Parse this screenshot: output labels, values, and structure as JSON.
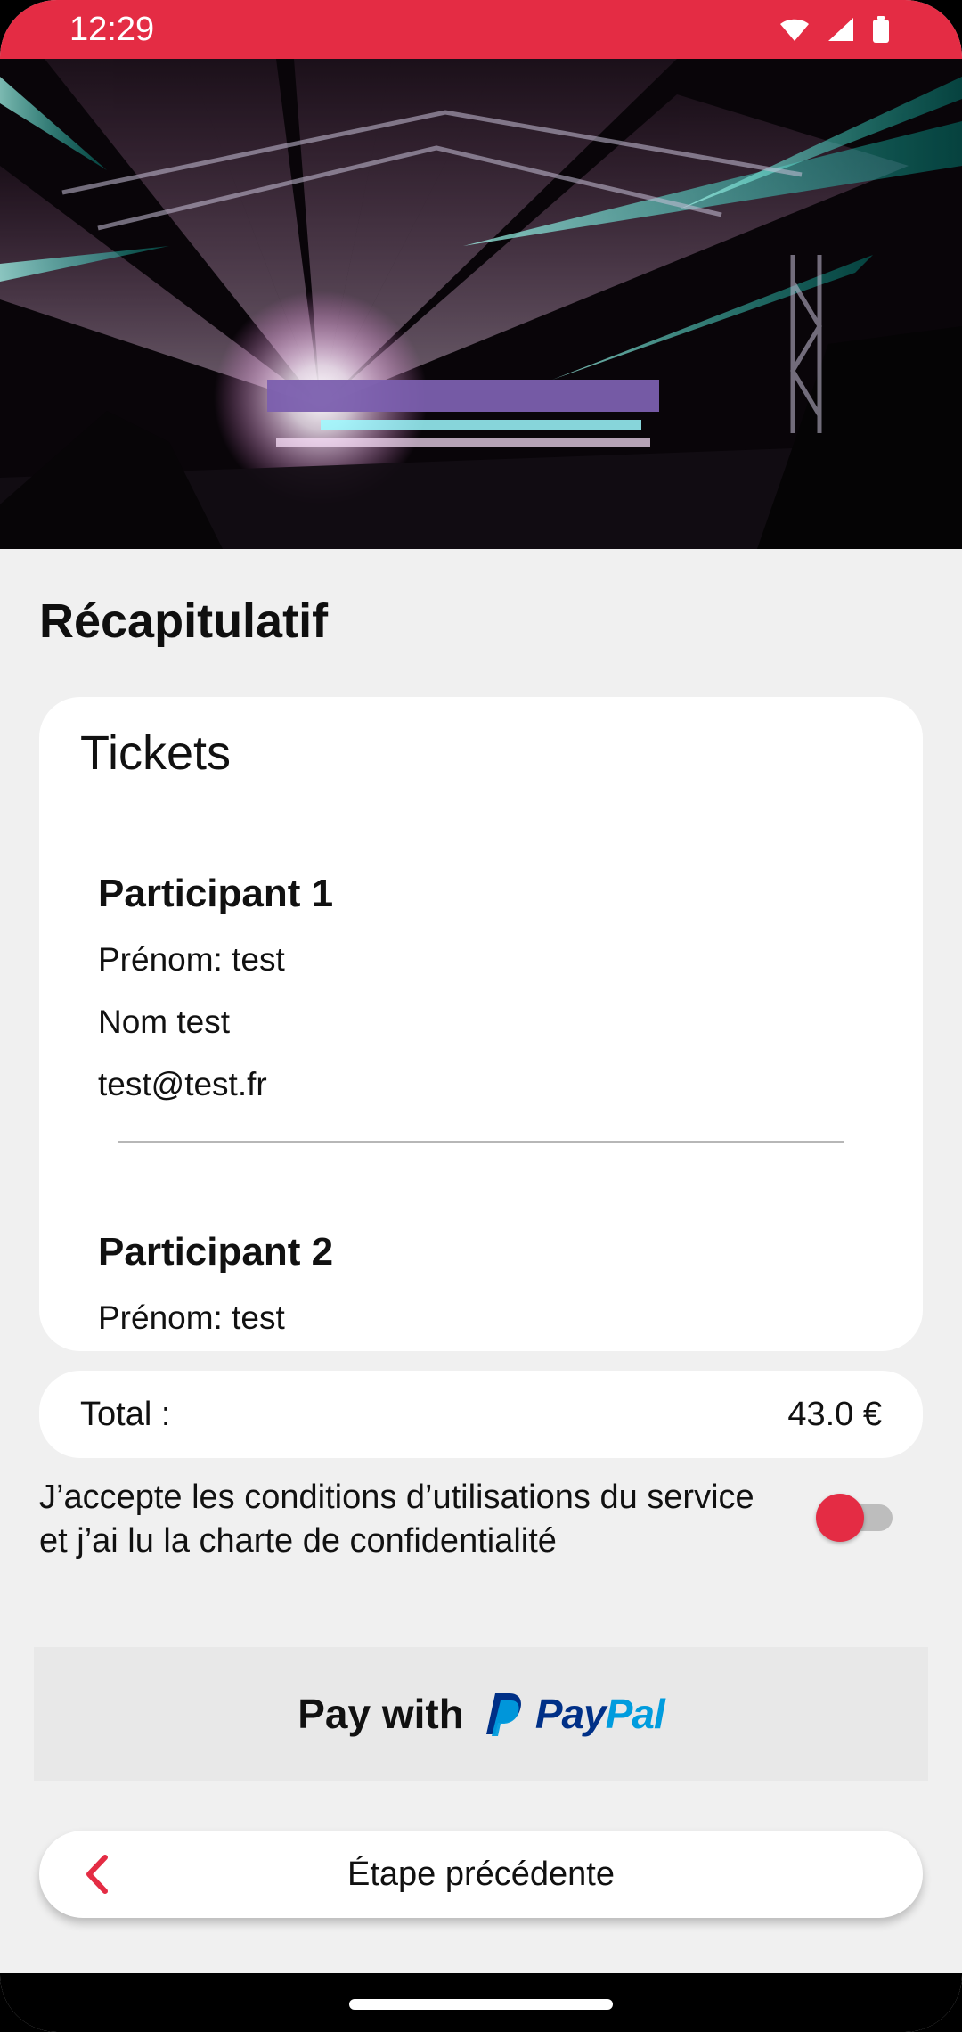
{
  "status_bar": {
    "time": "12:29"
  },
  "page": {
    "title": "Récapitulatif"
  },
  "tickets_card": {
    "title": "Tickets",
    "participants": [
      {
        "name": "Participant 1",
        "first_name_line": "Prénom: test",
        "last_name_line": "Nom test",
        "email": "test@test.fr"
      },
      {
        "name": "Participant 2",
        "first_name_line": "Prénom: test"
      }
    ]
  },
  "total": {
    "label": "Total :",
    "value": "43.0 €"
  },
  "consent": {
    "text": "J’accepte les conditions d’utilisations du service et j’ai lu la charte de confidentialité",
    "enabled": false
  },
  "paypal": {
    "pay_with_label": "Pay with",
    "logo_text_dark": "Pay",
    "logo_text_light": "Pal"
  },
  "navigation": {
    "back_label": "Étape précédente"
  },
  "colors": {
    "accent": "#e42c44",
    "background": "#f0f0f0",
    "card": "#ffffff",
    "paypal_dark": "#003087",
    "paypal_light": "#009cde"
  }
}
